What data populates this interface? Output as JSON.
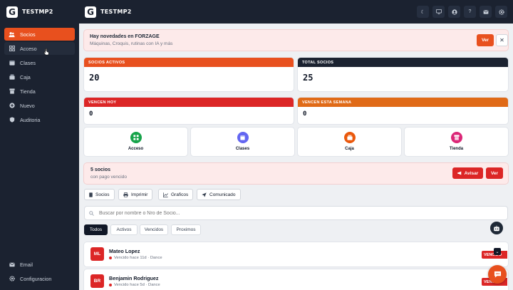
{
  "app": {
    "name": "TESTMP2",
    "logo_letter": "G"
  },
  "sidebar": {
    "items": [
      {
        "label": "Socios",
        "icon": "users-icon"
      },
      {
        "label": "Acceso",
        "icon": "grid-icon"
      },
      {
        "label": "Clases",
        "icon": "calendar-icon"
      },
      {
        "label": "Caja",
        "icon": "cashbox-icon"
      },
      {
        "label": "Tienda",
        "icon": "store-icon"
      },
      {
        "label": "Nuevo",
        "icon": "plus-circle-icon"
      },
      {
        "label": "Auditoria",
        "icon": "shield-icon"
      }
    ],
    "bottom": [
      {
        "label": "Email",
        "icon": "mail-icon"
      },
      {
        "label": "Configuracion",
        "icon": "gear-icon"
      }
    ]
  },
  "topbar": {
    "icons": [
      "moon-icon",
      "monitor-icon",
      "user-icon",
      "help-icon",
      "mail-icon",
      "gear-icon"
    ],
    "help_glyph": "?"
  },
  "banner": {
    "title": "Hay novedades en FORZAGE",
    "subtitle": "Máquinas, Croquis, rutinas con IA y más",
    "ver_label": "Ver",
    "close_glyph": "✕"
  },
  "stats": {
    "socios_activos": {
      "label": "SOCIOS ACTIVOS",
      "value": "20",
      "color": "#e8501e"
    },
    "total_socios": {
      "label": "TOTAL SOCIOS",
      "value": "25",
      "color": "#1b2230"
    },
    "vencen_hoy": {
      "label": "VENCEN HOY",
      "value": "0",
      "color": "#dc2626"
    },
    "vencen_semana": {
      "label": "VENCEN ESTA SEMANA",
      "value": "0",
      "color": "#e06a17"
    }
  },
  "quick_actions": [
    {
      "label": "Acceso",
      "icon": "grid-icon",
      "color": "#16a34a"
    },
    {
      "label": "Clases",
      "icon": "calendar-icon",
      "color": "#6366f1"
    },
    {
      "label": "Caja",
      "icon": "cashbox-icon",
      "color": "#ea580c"
    },
    {
      "label": "Tienda",
      "icon": "store-icon",
      "color": "#db2777"
    }
  ],
  "alert": {
    "title": "5 socios",
    "subtitle": "con pago vencido",
    "avisar_label": "Avisar",
    "ver_label": "Ver"
  },
  "toolbar": {
    "socios": "Socios",
    "imprimir": "Imprimir",
    "graficos": "Graficos",
    "comunicado": "Comunicado"
  },
  "search": {
    "placeholder": "Buscar por nombre o Nro de Socio..."
  },
  "filters": {
    "todos": "Todos",
    "activos": "Activos",
    "vencidos": "Vencidos",
    "proximos": "Proximos"
  },
  "members": [
    {
      "initials": "ML",
      "name": "Mateo Lopez",
      "meta": "Vencido hace 11d · Dance",
      "badge": "VENCIDO"
    },
    {
      "initials": "BR",
      "name": "Benjamin Rodriguez",
      "meta": "Vencido hace 5d · Dance",
      "badge": "VENCIDO"
    }
  ]
}
